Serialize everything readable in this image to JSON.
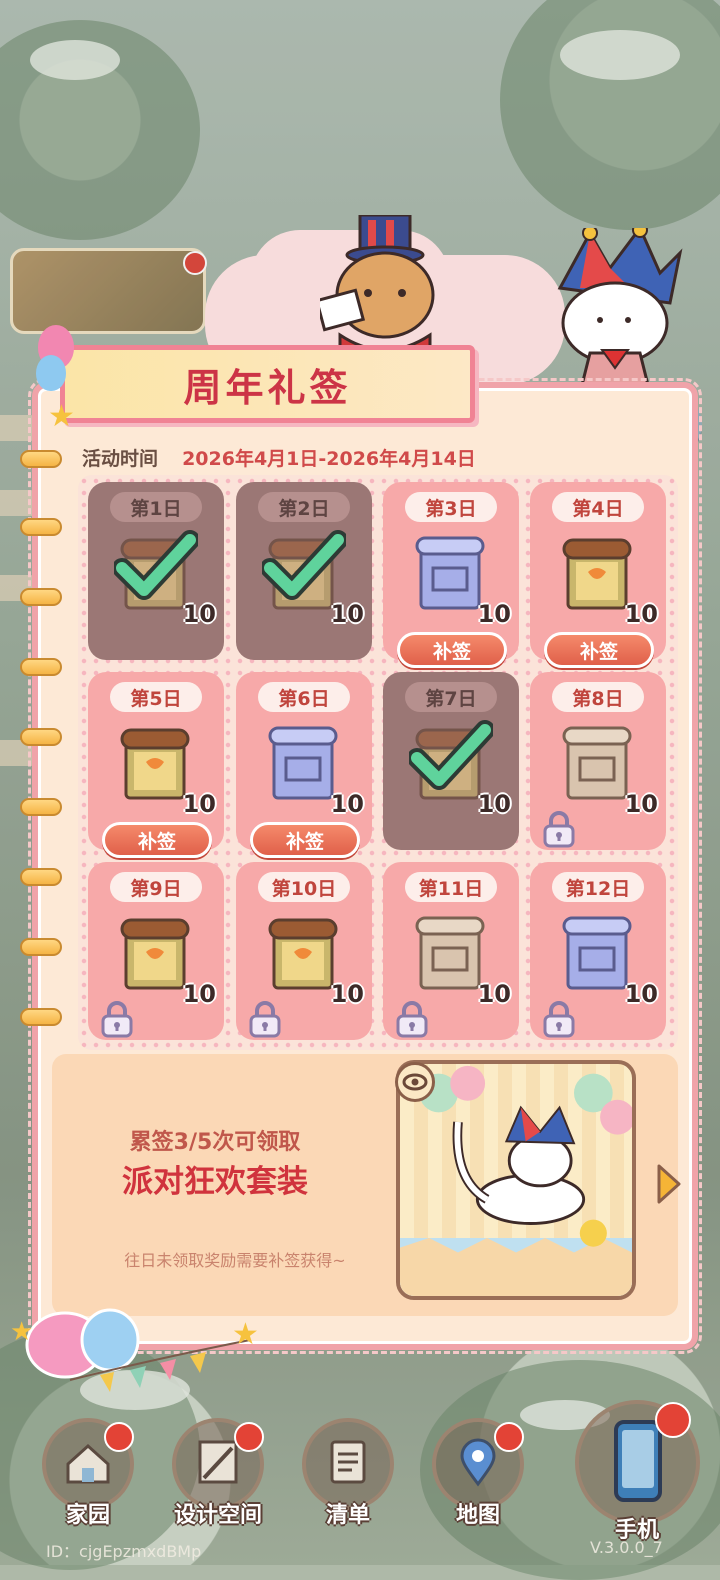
{
  "title": "周年礼签",
  "activity": {
    "label": "活动时间",
    "range": "2026年4月1日-2026年4月14日"
  },
  "days": [
    {
      "label": "第1日",
      "item": "wood-scroll",
      "qty": "10",
      "state": "claimed"
    },
    {
      "label": "第2日",
      "item": "wood-scroll",
      "qty": "10",
      "state": "claimed"
    },
    {
      "label": "第3日",
      "item": "blue-scroll",
      "qty": "10",
      "state": "missed",
      "button": "补签"
    },
    {
      "label": "第4日",
      "item": "wood-scroll",
      "qty": "10",
      "state": "missed",
      "button": "补签"
    },
    {
      "label": "第5日",
      "item": "wood-scroll",
      "qty": "10",
      "state": "missed",
      "button": "补签"
    },
    {
      "label": "第6日",
      "item": "blue-scroll",
      "qty": "10",
      "state": "missed",
      "button": "补签"
    },
    {
      "label": "第7日",
      "item": "wood-scroll",
      "qty": "10",
      "state": "claimed"
    },
    {
      "label": "第8日",
      "item": "beige-scroll",
      "qty": "10",
      "state": "locked"
    },
    {
      "label": "第9日",
      "item": "wood-scroll",
      "qty": "10",
      "state": "locked"
    },
    {
      "label": "第10日",
      "item": "wood-scroll",
      "qty": "10",
      "state": "locked"
    },
    {
      "label": "第11日",
      "item": "beige-scroll",
      "qty": "10",
      "state": "locked"
    },
    {
      "label": "第12日",
      "item": "blue-scroll",
      "qty": "10",
      "state": "locked"
    }
  ],
  "reward": {
    "progress": "累签3/5次可领取",
    "name": "派对狂欢套装",
    "note": "往日未领取奖励需要补签获得~"
  },
  "nav": [
    {
      "label": "家园",
      "icon": "home-icon",
      "badge": true
    },
    {
      "label": "设计空间",
      "icon": "design-icon",
      "badge": true
    },
    {
      "label": "清单",
      "icon": "list-icon",
      "badge": false
    },
    {
      "label": "地图",
      "icon": "map-icon",
      "badge": true
    },
    {
      "label": "手机",
      "icon": "phone-icon",
      "badge": true
    }
  ],
  "footer": {
    "id": "ID：cjgEpzmxdBMp",
    "version": "V.3.0.0_7"
  },
  "colors": {
    "accent": "#cc3446",
    "panel": "#fde9d6",
    "border": "#f0a3a9",
    "button": "#e0604a"
  }
}
